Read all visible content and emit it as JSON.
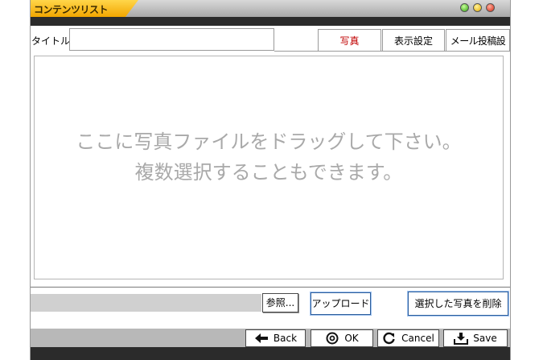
{
  "window": {
    "title": "コンテンツリスト"
  },
  "form": {
    "title_label": "タイトル:",
    "title_value": ""
  },
  "tabs": [
    {
      "label": "写真",
      "active": true
    },
    {
      "label": "表示設定",
      "active": false
    },
    {
      "label": "メール投稿設定",
      "active": false
    }
  ],
  "dropzone": {
    "line1": "ここに写真ファイルをドラッグして下さい。",
    "line2": "複数選択することもできます。"
  },
  "file_controls": {
    "path_value": "",
    "browse_label": "参照...",
    "upload_label": "アップロード",
    "delete_label": "選択した写真を削除"
  },
  "footer": {
    "back_label": "Back",
    "ok_label": "OK",
    "cancel_label": "Cancel",
    "save_label": "Save"
  },
  "colors": {
    "title_accent": "#f2a600",
    "active_tab_text": "#c00000",
    "placeholder_text": "#a9a9a9"
  },
  "icons": [
    "arrow-left-icon",
    "ok-circle-icon",
    "refresh-icon",
    "save-tray-icon"
  ]
}
